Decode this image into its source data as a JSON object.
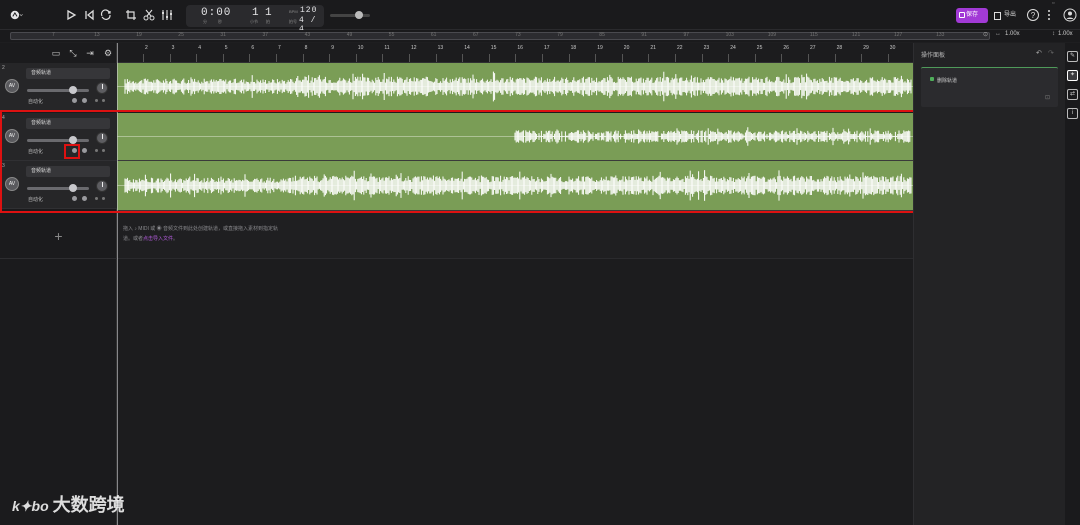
{
  "toolbar": {
    "logo_icon": "app-logo-icon",
    "transport": {
      "time": "0:00",
      "time_cap_left": "分",
      "time_cap_right": "秒",
      "bar": "1",
      "beat": "1",
      "bar_cap": "小节",
      "beat_cap": "拍",
      "bpm_label": "BPM",
      "bpm": "120",
      "sig_label": "拍号",
      "signature": "4 / 4"
    },
    "save_label": "保存",
    "export_label": "导出"
  },
  "overview": {
    "numbers": [
      "7",
      "13",
      "19",
      "25",
      "31",
      "37",
      "43",
      "49",
      "55",
      "61",
      "67",
      "73",
      "79",
      "85",
      "91",
      "97",
      "103",
      "109",
      "115",
      "121",
      "127",
      "133"
    ],
    "zoom_h": "1.00x",
    "zoom_v": "1.00x"
  },
  "ruler": {
    "ticks": [
      "2",
      "3",
      "4",
      "5",
      "6",
      "7",
      "8",
      "9",
      "10",
      "11",
      "12",
      "13",
      "14",
      "15",
      "16",
      "17",
      "18",
      "19",
      "20",
      "21",
      "22",
      "23",
      "24",
      "25",
      "26",
      "27",
      "28",
      "29",
      "30"
    ]
  },
  "tracks": [
    {
      "number": "2",
      "name": "音频轨道",
      "auto_label": "自动化",
      "avatar": "AV",
      "volume": 0.74
    },
    {
      "number": "4",
      "name": "音频轨道",
      "auto_label": "自动化",
      "avatar": "AV",
      "volume": 0.74
    },
    {
      "number": "3",
      "name": "音频轨道",
      "auto_label": "自动化",
      "avatar": "AV",
      "volume": 0.74
    }
  ],
  "drop_hint": {
    "line1": "拖入 ♪ MIDI 或 ◉ 音频文件到此处创建轨道，或直接拖入素材到指定轨",
    "line2_prefix": "道。或者",
    "line2_link": "点击导入文件",
    "line2_suffix": "。"
  },
  "right_panel": {
    "title": "操作面板",
    "item": "删除轨道"
  },
  "watermark": {
    "logo": "k✦bo",
    "text": "大数跨境"
  },
  "colors": {
    "waveform_bg": "#7a9d56",
    "highlight": "#dd1111",
    "accent": "#a23ad6"
  }
}
